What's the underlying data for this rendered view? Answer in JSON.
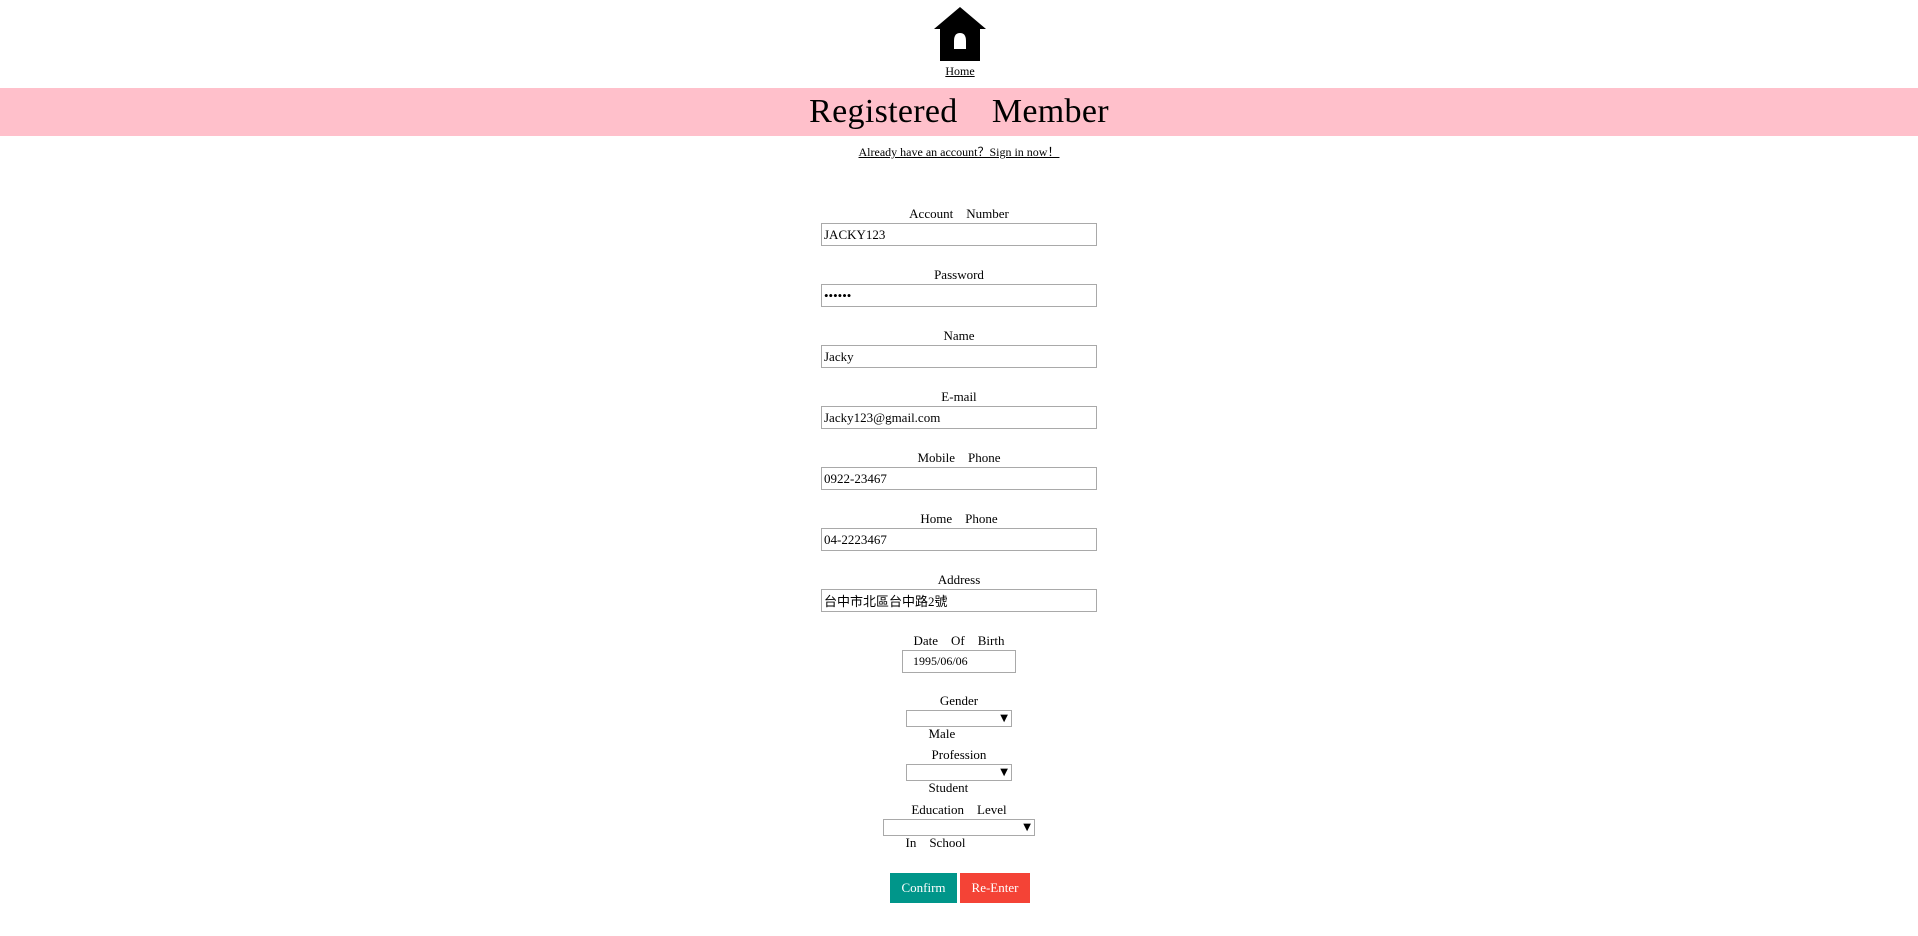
{
  "header": {
    "home_label": "Home",
    "title": "Registered　Member",
    "signin_text": "Already have an account？Sign in now！"
  },
  "form": {
    "account": {
      "label": "Account　Number",
      "value": "JACKY123"
    },
    "password": {
      "label": "Password",
      "value": "••••••"
    },
    "name": {
      "label": "Name",
      "value": "Jacky"
    },
    "email": {
      "label": "E-mail",
      "value": "Jacky123@gmail.com"
    },
    "mobile": {
      "label": "Mobile　Phone",
      "value": "0922-23467"
    },
    "home_phone": {
      "label": "Home　Phone",
      "value": "04-2223467"
    },
    "address": {
      "label": "Address",
      "value": "台中市北區台中路2號"
    },
    "dob": {
      "label": "Date　Of　Birth",
      "value": "1995/06/06"
    },
    "gender": {
      "label": "Gender",
      "selected": "Male"
    },
    "profession": {
      "label": "Profession",
      "selected": "Student"
    },
    "education": {
      "label": "Education　Level",
      "selected": "In　School"
    }
  },
  "buttons": {
    "confirm": "Confirm",
    "reenter": "Re-Enter"
  },
  "icons": {
    "home": "house-icon",
    "dropdown": "triangle-down-icon"
  },
  "colors": {
    "banner": "#ffc0cb",
    "confirm": "#00968a",
    "reenter": "#f44336"
  }
}
